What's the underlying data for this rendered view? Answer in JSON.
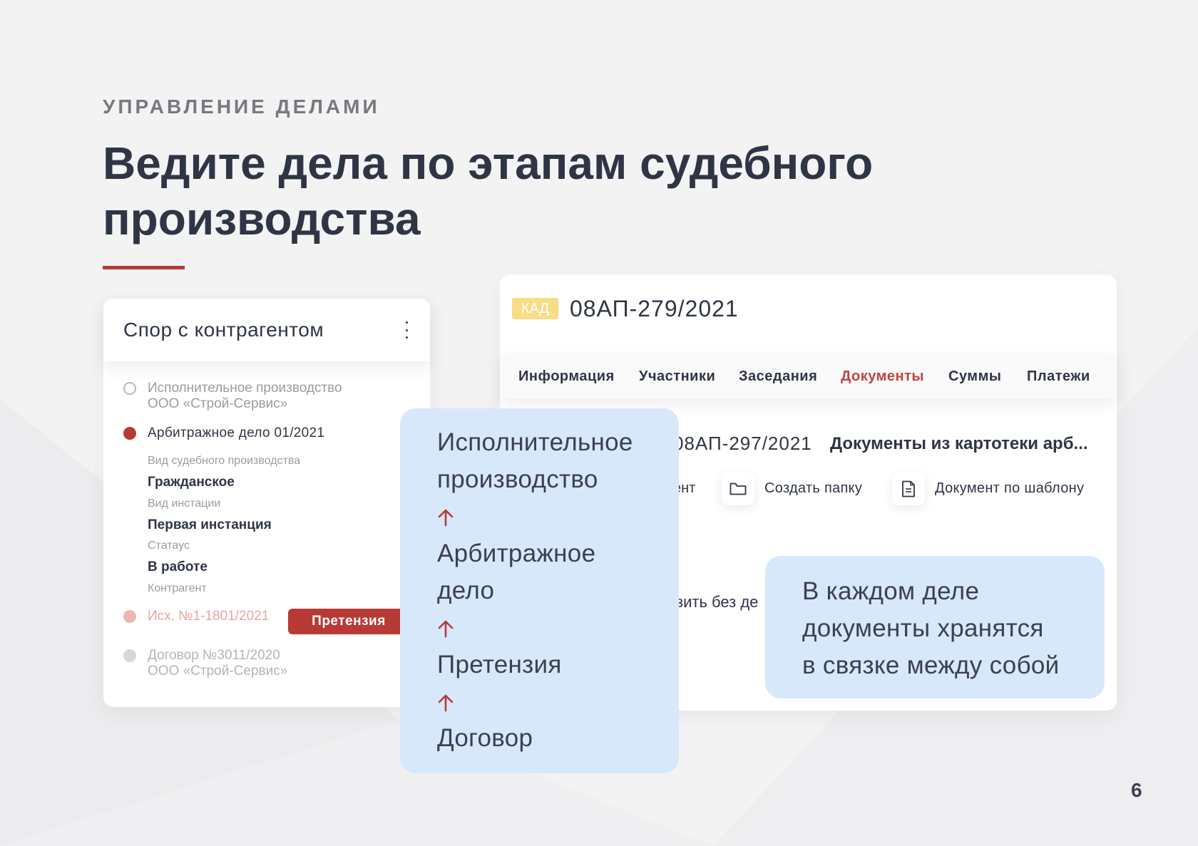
{
  "slide": {
    "eyebrow": "УПРАВЛЕНИЕ ДЕЛАМИ",
    "headline_line1": "Ведите дела по этапам судебного",
    "headline_line2": "производства",
    "page_number": "6",
    "accent_color": "#b73a35"
  },
  "left_card": {
    "title": "Спор с контрагентом",
    "menu_icon": "kebab-menu-icon",
    "items": [
      {
        "title": "Исполнительное производство",
        "subtitle": "ООО «Строй-Сервис»",
        "state": "empty"
      },
      {
        "title": "Арбитражное дело 01/2021",
        "state": "active"
      },
      {
        "title": "Исх. №1-1801/2021",
        "state": "faded",
        "badge": "Претензия"
      },
      {
        "title": "Договор №3011/2020",
        "subtitle": "ООО «Строй-Сервис»",
        "state": "inactive"
      }
    ],
    "fields": [
      {
        "label": "Вид судебного производства",
        "value": "Гражданское"
      },
      {
        "label": "Вид инстации",
        "value": "Первая инстанция"
      },
      {
        "label": "Статаус",
        "value": "В работе"
      },
      {
        "label": "Контрагент",
        "value": ""
      }
    ]
  },
  "right_card": {
    "badge": "КАД",
    "case_number": "08АП-279/2021",
    "tabs": [
      {
        "label": "Информация",
        "active": false
      },
      {
        "label": "Участники",
        "active": false
      },
      {
        "label": "Заседания",
        "active": false
      },
      {
        "label": "Документы",
        "active": true
      },
      {
        "label": "Суммы",
        "active": false
      },
      {
        "label": "Платежи",
        "active": false
      }
    ],
    "doc_row": {
      "number": "08АП-297/2021",
      "title": "Документы из картотеки арб..."
    },
    "actions": {
      "partial": "ент",
      "create_folder": "Создать папку",
      "template_doc": "Документ по шаблону"
    },
    "partial_text": "зить без де"
  },
  "flow_box": {
    "lines": [
      "Исполнительное",
      "производство",
      "Арбитражное",
      "дело",
      "Претензия",
      "Договор"
    ]
  },
  "note_box": {
    "lines": [
      "В каждом деле",
      "документы хранятся",
      "в связке между собой"
    ]
  }
}
